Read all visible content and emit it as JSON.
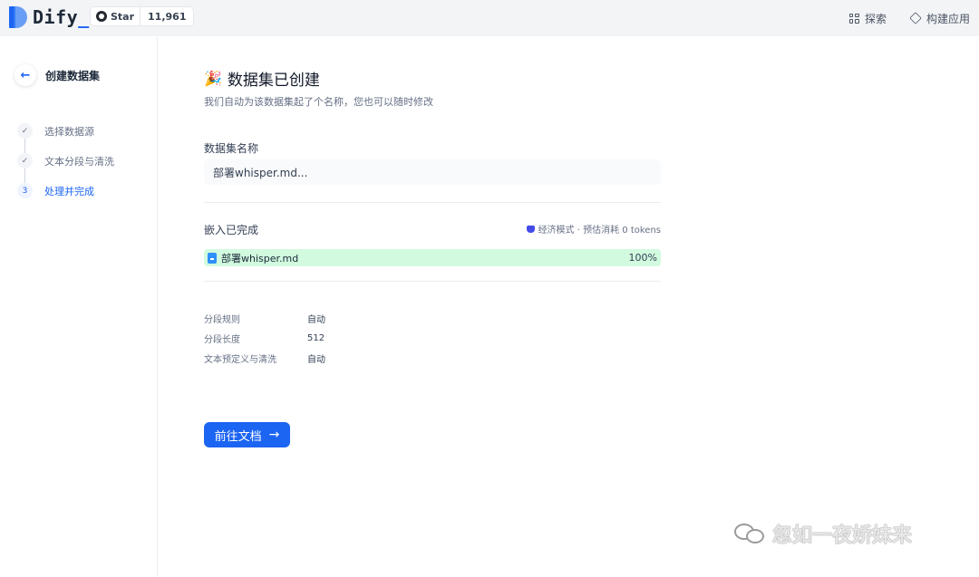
{
  "header": {
    "logo_text": "Dify",
    "logo_underscore": "_",
    "github": {
      "star_label": "Star",
      "count": "11,961"
    },
    "nav": [
      {
        "label": "探索",
        "icon": "grid-icon"
      },
      {
        "label": "构建应用",
        "icon": "cube-icon"
      }
    ]
  },
  "sidebar": {
    "title": "创建数据集",
    "back_icon": "←",
    "steps": [
      {
        "marker": "✓",
        "label": "选择数据源",
        "state": "done"
      },
      {
        "marker": "✓",
        "label": "文本分段与清洗",
        "state": "done"
      },
      {
        "marker": "3",
        "label": "处理并完成",
        "state": "active"
      }
    ]
  },
  "main": {
    "title_emoji": "🎉",
    "title": "数据集已创建",
    "subtitle": "我们自动为该数据集起了个名称，您也可以随时修改",
    "name_label": "数据集名称",
    "name_value": "部署whisper.md...",
    "embed_label": "嵌入已完成",
    "embed_mode": "经济模式 · 预估消耗 0 tokens",
    "file": {
      "name": "部署whisper.md",
      "progress": "100%"
    },
    "rules": [
      {
        "key": "分段规则",
        "value": "自动"
      },
      {
        "key": "分段长度",
        "value": "512"
      },
      {
        "key": "文本预定义与清洗",
        "value": "自动"
      }
    ],
    "go_button": "前往文档",
    "go_arrow": "→"
  },
  "watermark": {
    "text": "忽如一夜娇妹来"
  },
  "colors": {
    "accent": "#1c64f2",
    "progress_bg": "#d1fadf",
    "topbar_bg": "#f3f4f6"
  }
}
